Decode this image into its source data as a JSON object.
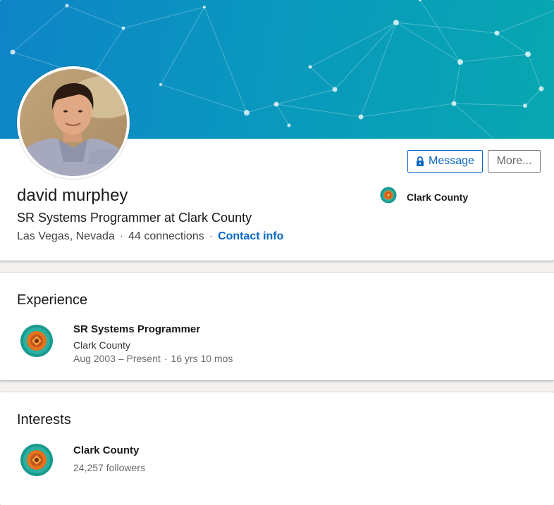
{
  "profile": {
    "name": "david murphey",
    "headline": "SR Systems Programmer at Clark County",
    "location": "Las Vegas, Nevada",
    "separator": "·",
    "connections": "44 connections",
    "contact_info_label": "Contact info",
    "current_company": "Clark County"
  },
  "actions": {
    "message_label": "Message",
    "more_label": "More..."
  },
  "experience": {
    "title": "Experience",
    "items": [
      {
        "role": "SR Systems Programmer",
        "company": "Clark County",
        "dates": "Aug 2003 – Present",
        "duration": "16 yrs 10 mos"
      }
    ]
  },
  "interests": {
    "title": "Interests",
    "items": [
      {
        "name": "Clark County",
        "followers": "24,257 followers"
      }
    ]
  },
  "colors": {
    "accent": "#0a66c2",
    "banner_start": "#0e84c7",
    "banner_end": "#07a7b0",
    "logo_ring": "#1a9a8e",
    "logo_center": "#e6731e"
  },
  "icons": {
    "message_button": "lock-icon",
    "company_logo": "clark-county-seal-icon"
  }
}
